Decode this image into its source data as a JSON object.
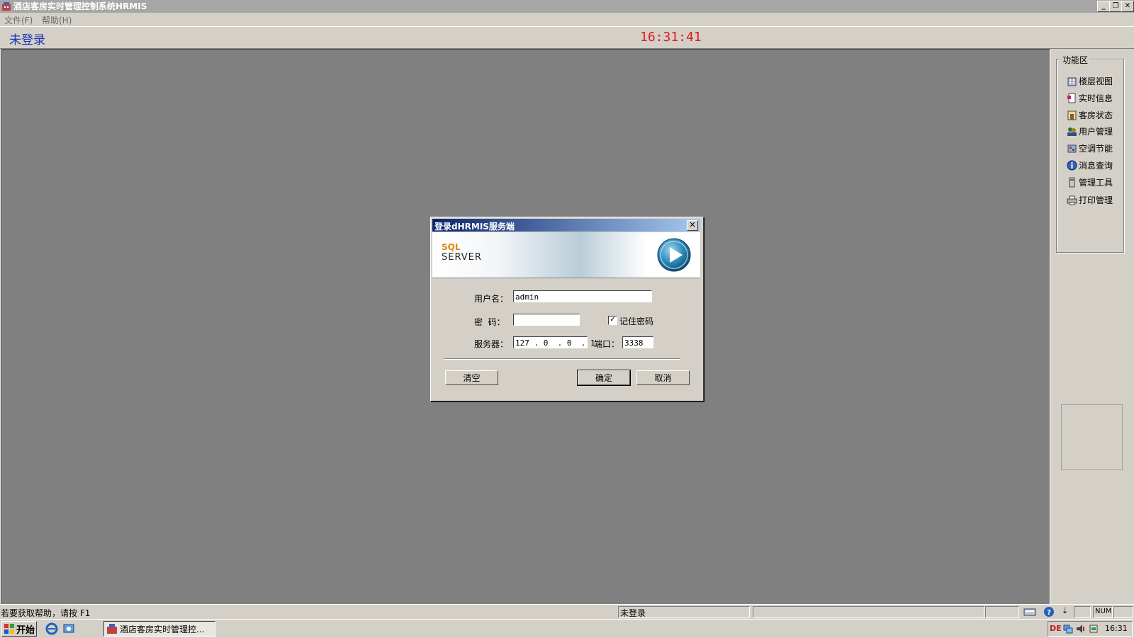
{
  "window": {
    "title": "酒店客房实时管理控制系统HRMIS",
    "minimize_label": "_",
    "restore_label": "❐",
    "close_label": "✕"
  },
  "menu": {
    "items": [
      {
        "label": "文件(F)"
      },
      {
        "label": "帮助(H)"
      }
    ]
  },
  "top_status": {
    "login_state": "未登录",
    "clock": "16:31:41",
    "login_color": "#1a33b3",
    "clock_color": "#e01a1a"
  },
  "function_panel": {
    "title": "功能区",
    "items": [
      {
        "label": "楼层视图",
        "icon": "building-icon"
      },
      {
        "label": "实时信息",
        "icon": "document-icon"
      },
      {
        "label": "客房状态",
        "icon": "room-icon"
      },
      {
        "label": "用户管理",
        "icon": "users-icon"
      },
      {
        "label": "空调节能",
        "icon": "aircon-icon"
      },
      {
        "label": "消息查询",
        "icon": "info-icon"
      },
      {
        "label": "管理工具",
        "icon": "tool-icon"
      },
      {
        "label": "打印管理",
        "icon": "printer-icon"
      }
    ]
  },
  "login_dialog": {
    "title": "登录dHRMIS服务端",
    "banner": {
      "sql": "SQL",
      "server": "SERVER"
    },
    "username_label": "用户名：",
    "username_value": "admin",
    "password_label": "密  码：",
    "password_value": "",
    "remember_label": "记住密码",
    "remember_checked": true,
    "server_label": "服务器：",
    "server_value": "127 . 0  . 0  . 1",
    "port_label": "端口：",
    "port_value": "3338",
    "clear_label": "清空",
    "ok_label": "确定",
    "cancel_label": "取消"
  },
  "bottom_status": {
    "help_text": "若要获取帮助，请按 F1",
    "login_state": "未登录",
    "num_label": "NUM"
  },
  "taskbar": {
    "start_label": "开始",
    "window_label": "酒店客房实时管理控...",
    "tray_time": "16:31"
  }
}
